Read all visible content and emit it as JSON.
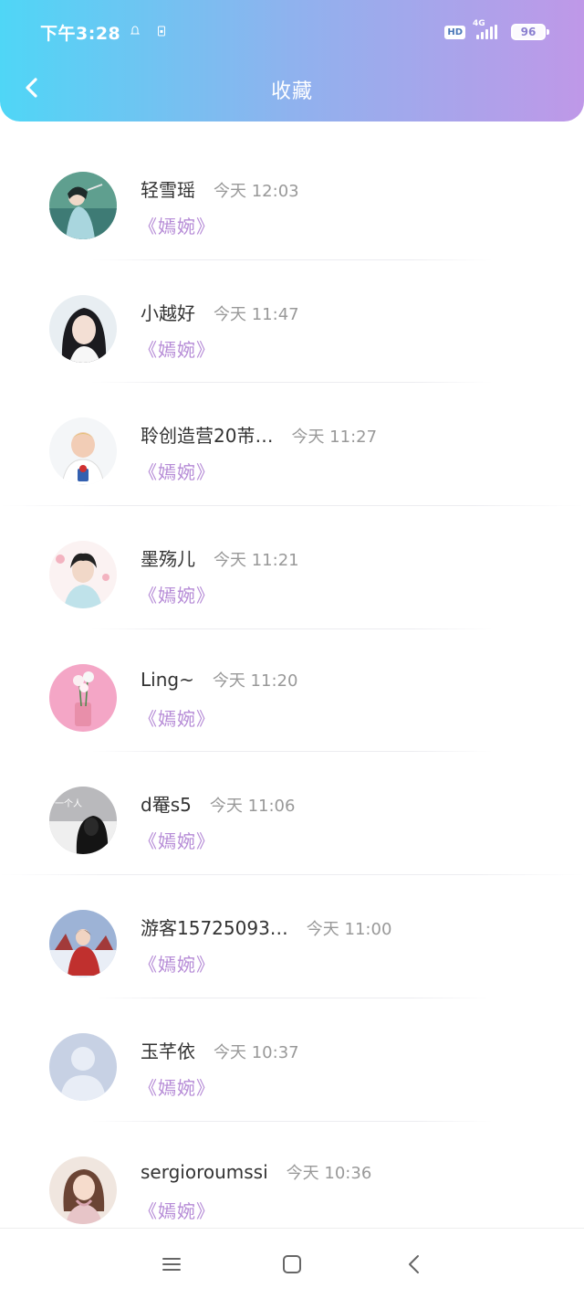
{
  "status_bar": {
    "time": "下午3:28",
    "hd": "HD",
    "network": "4G",
    "battery": "96"
  },
  "header": {
    "title": "收藏",
    "back_icon": "chevron-left-icon"
  },
  "favorites": [
    {
      "name": "轻雪瑶",
      "time": "今天 12:03",
      "work": "《嫣婉》"
    },
    {
      "name": "小越好",
      "time": "今天 11:47",
      "work": "《嫣婉》"
    },
    {
      "name": "聆创造营20芾…",
      "time": "今天 11:27",
      "work": "《嫣婉》"
    },
    {
      "name": "墨殇儿",
      "time": "今天 11:21",
      "work": "《嫣婉》"
    },
    {
      "name": "Ling~",
      "time": "今天 11:20",
      "work": "《嫣婉》"
    },
    {
      "name": "d罨s5",
      "time": "今天 11:06",
      "work": "《嫣婉》"
    },
    {
      "name": "游客15725093…",
      "time": "今天 11:00",
      "work": "《嫣婉》"
    },
    {
      "name": "玉芊依",
      "time": "今天 10:37",
      "work": "《嫣婉》"
    },
    {
      "name": "sergioroumssi",
      "time": "今天 10:36",
      "work": "《嫣婉》"
    }
  ],
  "avatar_texts": {
    "d_avatar_caption": "一个人"
  },
  "nav_bar": {
    "menu_icon": "menu-icon",
    "home_icon": "home-square-icon",
    "back_icon": "back-triangle-icon"
  },
  "colors": {
    "header_gradient_start": "#4fd6f6",
    "header_gradient_end": "#bf98e8",
    "work_title": "#b58ad6",
    "time_text": "#999999"
  }
}
